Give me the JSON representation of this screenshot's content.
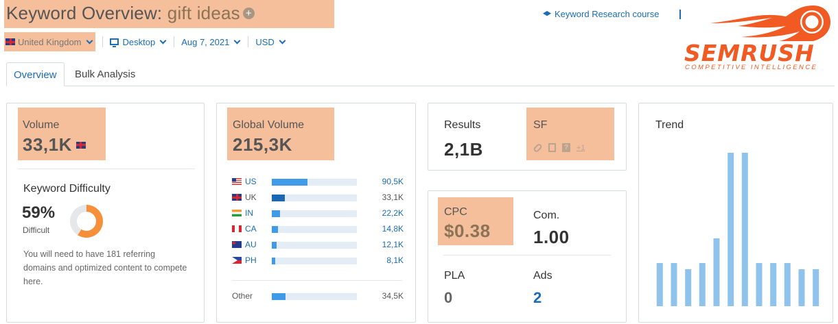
{
  "header": {
    "title_prefix": "Keyword Overview:",
    "keyword": "gift ideas",
    "plus_symbol": "+"
  },
  "filters": {
    "database": "United Kingdom",
    "device": "Desktop",
    "date": "Aug 7, 2021",
    "currency": "USD"
  },
  "course_link": "Keyword Research course",
  "logo": {
    "wordmark": "SEMRUSH",
    "tagline": "COMPETITIVE INTELLIGENCE",
    "brand_color": "#f15a22"
  },
  "tabs": [
    {
      "label": "Overview",
      "active": true
    },
    {
      "label": "Bulk Analysis",
      "active": false
    }
  ],
  "volume": {
    "label": "Volume",
    "value": "33,1K"
  },
  "keyword_difficulty": {
    "label": "Keyword Difficulty",
    "percent": "59%",
    "percent_value": 59,
    "level": "Difficult",
    "description": "You will need to have 181 referring domains and optimized content to compete here.",
    "color": "#f58f3a"
  },
  "global_volume": {
    "label": "Global Volume",
    "value": "215,3K",
    "countries": [
      {
        "code": "US",
        "flag": "us-flag-icon",
        "value": "90,5K",
        "share": 0.42,
        "highlight": false
      },
      {
        "code": "UK",
        "flag": "uk-flag-icon",
        "value": "33,1K",
        "share": 0.15,
        "highlight": true
      },
      {
        "code": "IN",
        "flag": "india-flag-icon",
        "value": "22,2K",
        "share": 0.1,
        "highlight": false
      },
      {
        "code": "CA",
        "flag": "canada-flag-icon",
        "value": "14,8K",
        "share": 0.07,
        "highlight": false
      },
      {
        "code": "AU",
        "flag": "australia-flag-icon",
        "value": "12,1K",
        "share": 0.056,
        "highlight": false
      },
      {
        "code": "PH",
        "flag": "philippines-flag-icon",
        "value": "8,1K",
        "share": 0.038,
        "highlight": false
      }
    ],
    "other": {
      "label": "Other",
      "value": "34,5K",
      "share": 0.16
    }
  },
  "results": {
    "label": "Results",
    "value": "2,1B"
  },
  "serp_features": {
    "label": "SF",
    "icons": [
      "link-icon",
      "document-icon",
      "question-icon"
    ],
    "more": "+1"
  },
  "cpc": {
    "label": "CPC",
    "value": "$0.38"
  },
  "competition": {
    "label": "Com.",
    "value": "1.00"
  },
  "pla": {
    "label": "PLA",
    "value": "0"
  },
  "ads": {
    "label": "Ads",
    "value": "2"
  },
  "trend": {
    "label": "Trend",
    "color": "#8fc3ec"
  },
  "chart_data": {
    "type": "bar",
    "title": "Trend",
    "values": [
      0.28,
      0.28,
      0.24,
      0.28,
      0.44,
      1.0,
      1.0,
      0.28,
      0.28,
      0.28,
      0.24,
      0.24
    ],
    "ylim": [
      0,
      1
    ],
    "grid": false
  }
}
